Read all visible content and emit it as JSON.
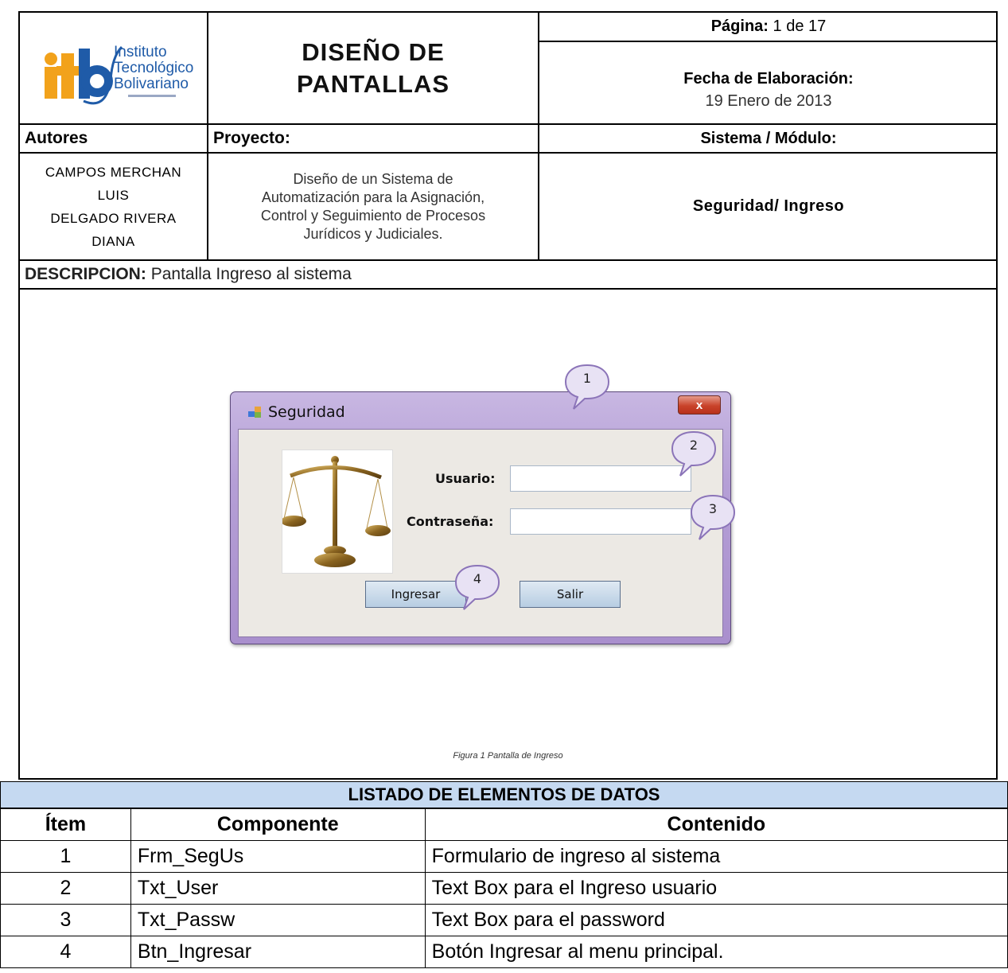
{
  "header": {
    "logo_text": [
      "Instituto",
      "Tecnológico",
      "Bolivariano"
    ],
    "logo_mark": "itb",
    "title_line1": "DISEÑO DE",
    "title_line2": "PANTALLAS",
    "page_label": "Página:",
    "page_value": "1 de 17",
    "date_label": "Fecha de Elaboración:",
    "date_value": "19 Enero de 2013",
    "autores_label": "Autores",
    "proyecto_label": "Proyecto:",
    "sistema_label": "Sistema / Módulo:",
    "autores": [
      "CAMPOS MERCHAN",
      "LUIS",
      "DELGADO RIVERA",
      "DIANA"
    ],
    "proyecto": [
      "Diseño de un Sistema de",
      "Automatización para la Asignación,",
      "Control y Seguimiento de Procesos",
      "Jurídicos y Judiciales."
    ],
    "sistema": "Seguridad/ Ingreso",
    "descripcion_label": "DESCRIPCION:",
    "descripcion": "Pantalla Ingreso al sistema"
  },
  "figure": {
    "window_title": "Seguridad",
    "close_glyph": "x",
    "usuario_label": "Usuario:",
    "contrasena_label": "Contraseña:",
    "ingresar_label": "Ingresar",
    "salir_label": "Salir",
    "bubbles": [
      "1",
      "2",
      "3",
      "4"
    ],
    "caption": "Figura 1 Pantalla de Ingreso",
    "icon": "scales-of-justice-icon"
  },
  "list": {
    "title": "LISTADO DE ELEMENTOS DE DATOS",
    "columns": [
      "Ítem",
      "Componente",
      "Contenido"
    ],
    "rows": [
      [
        "1",
        "Frm_SegUs",
        "Formulario de ingreso al sistema"
      ],
      [
        "2",
        "Txt_User",
        "Text Box para el Ingreso usuario"
      ],
      [
        "3",
        "Txt_Passw",
        "Text Box para el password"
      ],
      [
        "4",
        "Btn_Ingresar",
        "Botón Ingresar al menu principal."
      ]
    ]
  },
  "colors": {
    "list_header_bg": "#c5d9f1",
    "logo_orange": "#f2a21b",
    "logo_blue": "#1f5ba8",
    "bubble_fill": "#e8e2f4",
    "bubble_stroke": "#8b74b8"
  }
}
